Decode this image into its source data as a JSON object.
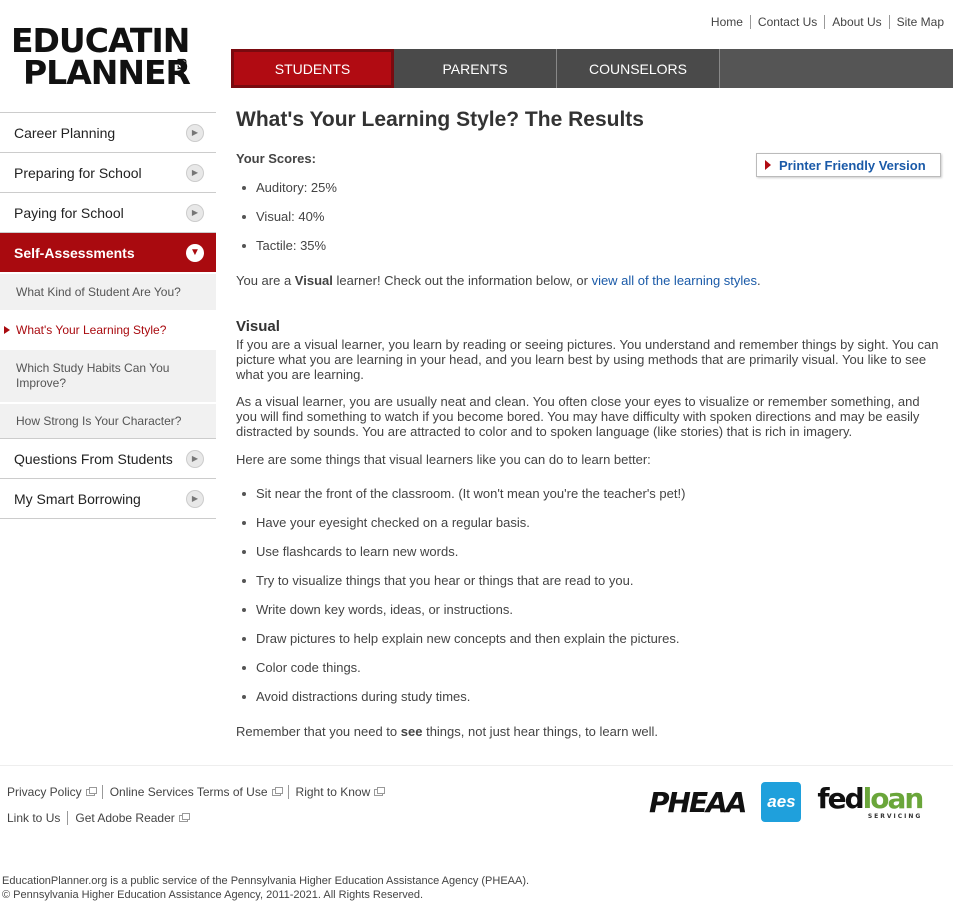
{
  "logo": {
    "line1": "EDUCATI",
    "line1b": "N",
    "line2": "PLANNER",
    "org": ".org"
  },
  "utility_links": [
    "Home",
    "Contact Us",
    "About Us",
    "Site Map"
  ],
  "topnav": {
    "tabs": [
      {
        "label": "STUDENTS",
        "active": true
      },
      {
        "label": "PARENTS",
        "active": false
      },
      {
        "label": "COUNSELORS",
        "active": false
      }
    ]
  },
  "sidebar": {
    "items": [
      {
        "label": "Career Planning"
      },
      {
        "label": "Preparing for School"
      },
      {
        "label": "Paying for School"
      },
      {
        "label": "Self-Assessments"
      }
    ],
    "sub_items": [
      {
        "label": "What Kind of Student Are You?"
      },
      {
        "label": "What's Your Learning Style?"
      },
      {
        "label": "Which Study Habits Can You Improve?"
      },
      {
        "label": "How Strong Is Your Character?"
      }
    ],
    "bottom_items": [
      {
        "label": "Questions From Students"
      },
      {
        "label": "My Smart Borrowing"
      }
    ]
  },
  "main": {
    "title": "What's Your Learning Style? The Results",
    "scores_label": "Your Scores:",
    "print_label": "Printer Friendly Version",
    "scores": [
      "Auditory: 25%",
      "Visual: 40%",
      "Tactile: 35%"
    ],
    "result_pre": "You are a ",
    "result_style": "Visual",
    "result_mid": " learner! Check out the information below, or ",
    "result_link": "view all of the learning styles",
    "result_post": ".",
    "section_title": "Visual",
    "para1": "If you are a visual learner, you learn by reading or seeing pictures. You understand and remember things by sight. You can picture what you are learning in your head, and you learn best by using methods that are primarily visual. You like to see what you are learning.",
    "para2": "As a visual learner, you are usually neat and clean. You often close your eyes to visualize or remember something, and you will find something to watch if you become bored. You may have difficulty with spoken directions and may be easily distracted by sounds. You are attracted to color and to spoken language (like stories) that is rich in imagery.",
    "tips_intro": "Here are some things that visual learners like you can do to learn better:",
    "tips": [
      "Sit near the front of the classroom. (It won't mean you're the teacher's pet!)",
      "Have your eyesight checked on a regular basis.",
      "Use flashcards to learn new words.",
      "Try to visualize things that you hear or things that are read to you.",
      "Write down key words, ideas, or instructions.",
      "Draw pictures to help explain new concepts and then explain the pictures.",
      "Color code things.",
      "Avoid distractions during study times."
    ],
    "closing_pre": "Remember that you need to ",
    "closing_bold": "see",
    "closing_post": " things, not just hear things, to learn well."
  },
  "footer": {
    "links_row1": [
      "Privacy Policy",
      "Online Services Terms of Use",
      "Right to Know"
    ],
    "links_row2": [
      "Link to Us",
      "Get Adobe Reader"
    ],
    "partners": {
      "pheaa": "PHEAA",
      "aes": "aes",
      "fed": "fed",
      "loan": "loan",
      "servicing": "SERVICING"
    },
    "legal1": "EducationPlanner.org is a public service of the Pennsylvania Higher Education Assistance Agency (PHEAA).",
    "legal2": "© Pennsylvania Higher Education Assistance Agency, 2011-2021. All Rights Reserved."
  }
}
